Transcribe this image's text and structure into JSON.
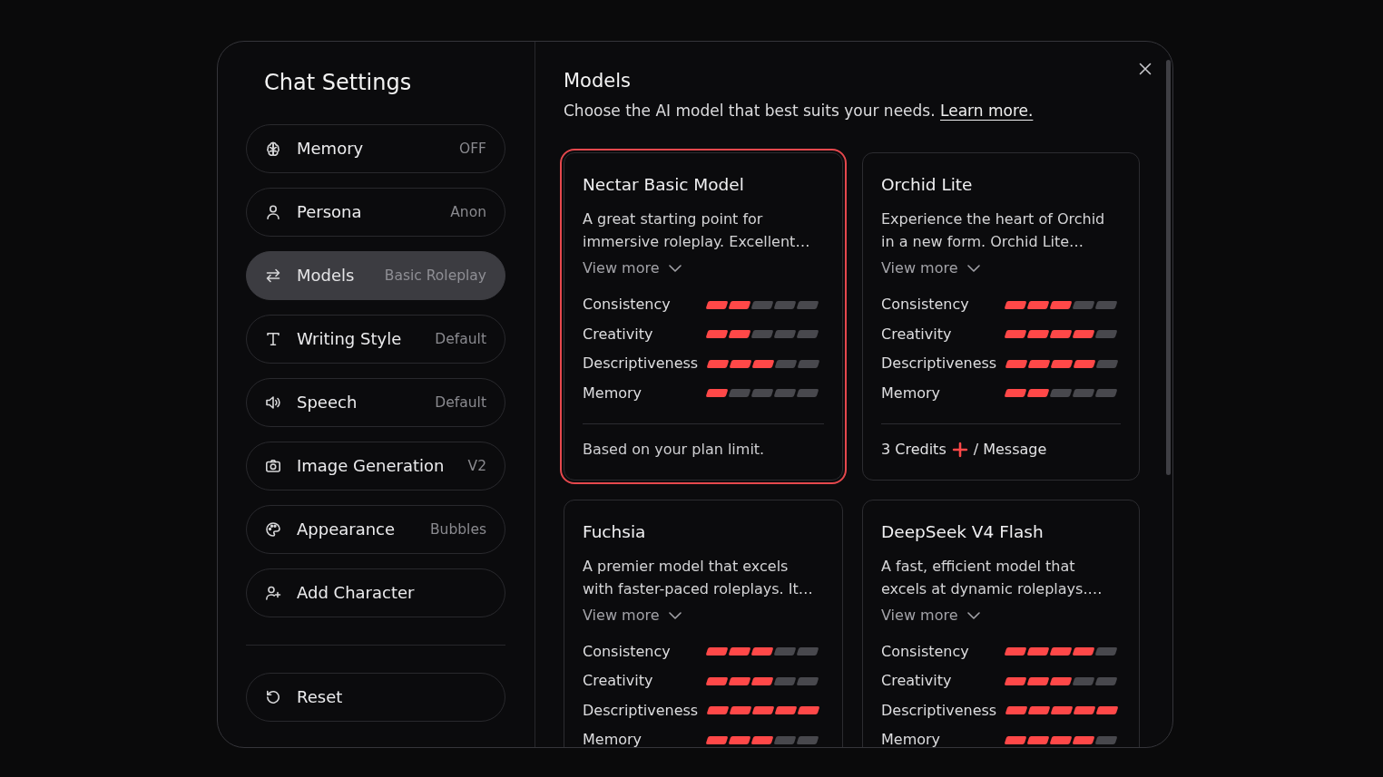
{
  "sidebar": {
    "title": "Chat Settings",
    "items": [
      {
        "kind": "memory",
        "label": "Memory",
        "value": "OFF",
        "selected": false
      },
      {
        "kind": "persona",
        "label": "Persona",
        "value": "Anon",
        "selected": false
      },
      {
        "kind": "models",
        "label": "Models",
        "value": "Basic Roleplay",
        "selected": true
      },
      {
        "kind": "writing_style",
        "label": "Writing Style",
        "value": "Default",
        "selected": false
      },
      {
        "kind": "speech",
        "label": "Speech",
        "value": "Default",
        "selected": false
      },
      {
        "kind": "image_generation",
        "label": "Image Generation",
        "value": "V2",
        "selected": false
      },
      {
        "kind": "appearance",
        "label": "Appearance",
        "value": "Bubbles",
        "selected": false
      },
      {
        "kind": "add_character",
        "label": "Add Character",
        "selected": false
      }
    ],
    "actions": [
      {
        "kind": "reset",
        "label": "Reset"
      }
    ]
  },
  "panel": {
    "title": "Models",
    "description": "Choose the AI model that best suits your needs.",
    "link": "Learn more.",
    "models": [
      {
        "name": "Nectar Basic Model",
        "description": [
          "A great starting point for",
          "immersive roleplay. Excellent…"
        ],
        "view_more": "View more",
        "selected": true,
        "ratings": [
          {
            "label": "Consistency",
            "stars": 2
          },
          {
            "label": "Creativity",
            "stars": 2
          },
          {
            "label": "Descriptiveness",
            "stars": 3
          },
          {
            "label": "Memory",
            "stars": 1
          }
        ],
        "footer": {
          "kind": "note",
          "text": "Based on your plan limit."
        }
      },
      {
        "name": "Orchid Lite",
        "description": [
          "Experience the heart of Orchid",
          "in a new form. Orchid Lite…"
        ],
        "view_more": "View more",
        "selected": false,
        "ratings": [
          {
            "label": "Consistency",
            "stars": 3
          },
          {
            "label": "Creativity",
            "stars": 4
          },
          {
            "label": "Descriptiveness",
            "stars": 4
          },
          {
            "label": "Memory",
            "stars": 2
          }
        ],
        "footer": {
          "kind": "credits",
          "amount": "3 Credits",
          "unit": "/ Message"
        }
      },
      {
        "name": "Fuchsia",
        "description": [
          "A premier model that excels",
          "with faster-paced roleplays. It…"
        ],
        "view_more": "View more",
        "selected": false,
        "ratings": [
          {
            "label": "Consistency",
            "stars": 3
          },
          {
            "label": "Creativity",
            "stars": 3
          },
          {
            "label": "Descriptiveness",
            "stars": 5
          },
          {
            "label": "Memory",
            "stars": 3
          }
        ]
      },
      {
        "name": "DeepSeek V4 Flash",
        "description": [
          "A fast, efficient model that",
          "excels at dynamic roleplays.…"
        ],
        "view_more": "View more",
        "selected": false,
        "ratings": [
          {
            "label": "Consistency",
            "stars": 4
          },
          {
            "label": "Creativity",
            "stars": 3
          },
          {
            "label": "Descriptiveness",
            "stars": 5
          },
          {
            "label": "Memory",
            "stars": 4
          }
        ]
      }
    ]
  }
}
